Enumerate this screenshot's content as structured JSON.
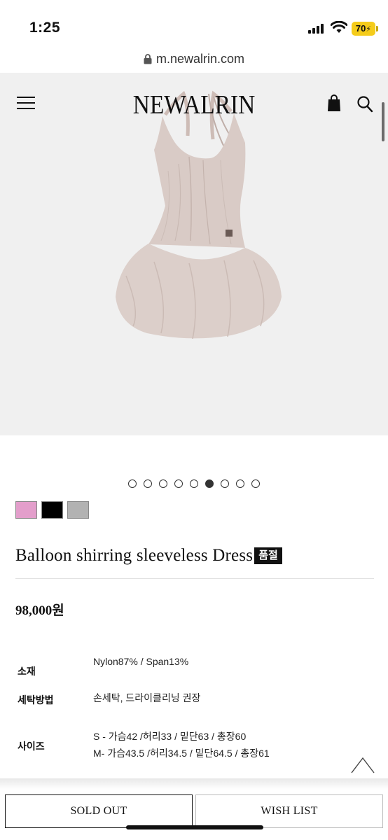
{
  "status_bar": {
    "time": "1:25",
    "battery": "70"
  },
  "browser": {
    "url": "m.newalrin.com"
  },
  "header": {
    "logo": "NEWALRIN"
  },
  "carousel": {
    "total": 9,
    "active_index": 5
  },
  "swatches": [
    {
      "name": "pink",
      "color": "#e39ecb"
    },
    {
      "name": "black",
      "color": "#000000"
    },
    {
      "name": "gray",
      "color": "#b2b2b2"
    }
  ],
  "product": {
    "title": "Balloon shirring sleeveless Dress",
    "badge": "품절",
    "price": "98,000원"
  },
  "info": {
    "material_label": "소재",
    "material_value": "Nylon87% / Span13%",
    "washing_label": "세탁방법",
    "washing_value": "손세탁, 드라이클리닝 권장",
    "size_label": "사이즈",
    "size_s": "S - 가슴42 /허리33 / 밑단63 / 총장60",
    "size_m": "M- 가슴43.5 /허리34.5 / 밑단64.5 / 총장61"
  },
  "actions": {
    "sold_out": "SOLD OUT",
    "wish_list": "WISH LIST"
  },
  "colors": {
    "dress": "#d9cbc6",
    "image_bg": "#f0f0f0",
    "battery": "#f5cc1a"
  }
}
